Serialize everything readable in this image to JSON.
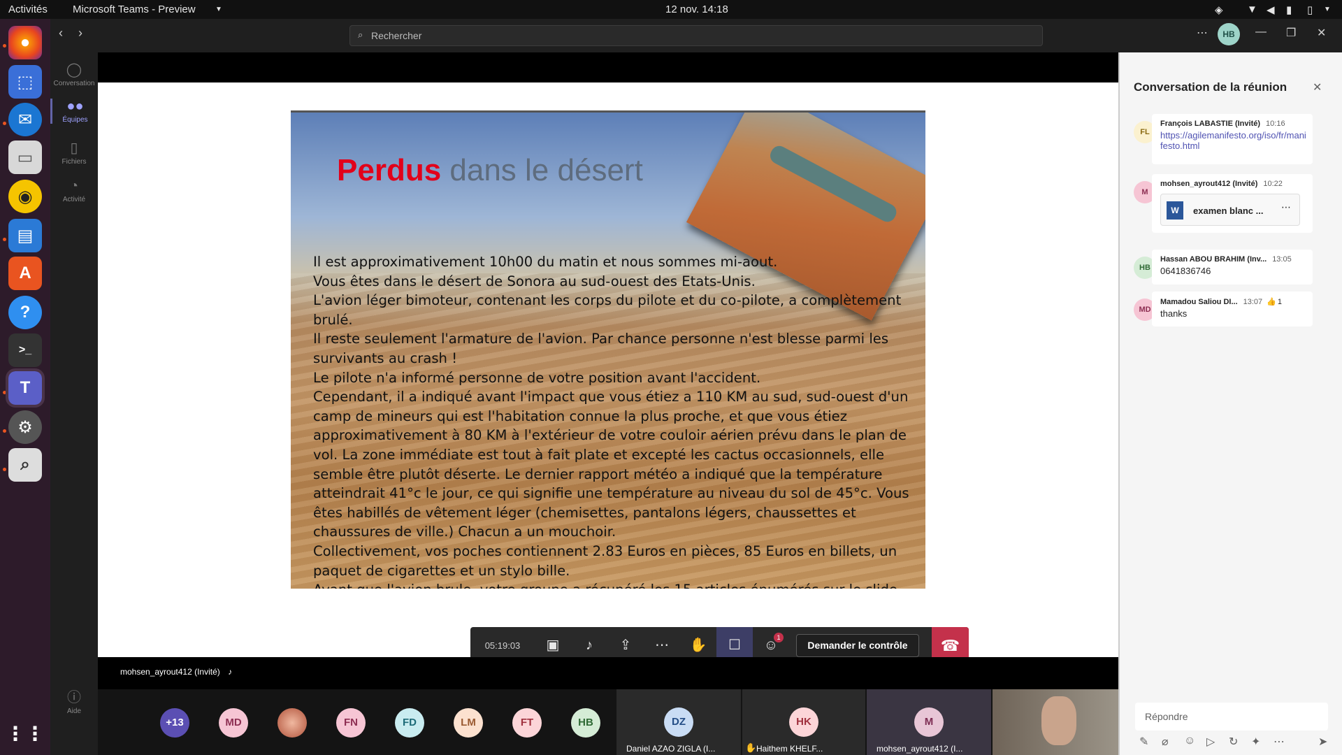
{
  "system": {
    "activities": "Activités",
    "app_name": "Microsoft Teams - Preview",
    "datetime": "12 nov.  14:18"
  },
  "dock": {
    "apps": [
      "Firefox",
      "Screenshot",
      "Thunderbird",
      "Files",
      "Rhythmbox",
      "LibreOffice Writer",
      "Ubuntu Software",
      "Help",
      "Terminal",
      "Microsoft Teams",
      "Settings",
      "Search"
    ]
  },
  "rail": {
    "items": [
      "Conversation",
      "Équipes",
      "Fichiers",
      "Activité"
    ],
    "help": "Aide"
  },
  "topbar": {
    "search_placeholder": "Rechercher",
    "user_initials": "HB"
  },
  "slide": {
    "title_red": "Perdus",
    "title_rest": " dans le désert",
    "lines": [
      "Il est approximativement 10h00 du matin et nous sommes mi-aout.",
      "Vous êtes dans le désert de Sonora au sud-ouest des Etats-Unis.",
      "L'avion léger bimoteur, contenant les corps du pilote et du co-pilote, a complètement brulé.",
      "Il reste seulement l'armature de l'avion. Par chance personne n'est blesse parmi les survivants au crash !",
      "Le pilote n'a informé personne de votre position avant l'accident.",
      "Cependant, il a indiqué avant l'impact que vous étiez a 110 KM au sud, sud-ouest d'un camp de mineurs qui est l'habitation connue la plus proche, et que vous étiez approximativement à 80 KM à l'extérieur de votre couloir aérien prévu dans le plan de vol. La zone immédiate est tout à fait plate et excepté les cactus occasionnels, elle semble être plutôt déserte. Le dernier rapport météo a indiqué que la température atteindrait 41°c le jour, ce qui signifie une température au niveau du sol de 45°c. Vous êtes habillés de vêtement léger (chemisettes, pantalons légers, chaussettes et chaussures de ville.) Chacun a un mouchoir.",
      "Collectivement, vos poches contiennent 2.83 Euros en pièces, 85 Euros en billets, un paquet de cigarettes et un stylo bille.",
      "Avant que l'avion brule, votre groupe a récupéré les 15 articles énumérés sur le slide suivant"
    ]
  },
  "controls": {
    "timer": "05:19:03",
    "participants_badge": "1",
    "request_control": "Demander le contrôle"
  },
  "presenter": {
    "name": "mohsen_ayrout412 (Invité)"
  },
  "participants": {
    "overflow": "+13",
    "avatars": [
      "MD",
      "",
      "FN",
      "FD",
      "LM",
      "FT",
      "HB"
    ],
    "tiles": [
      {
        "initials": "DZ",
        "name": "Daniel AZAO ZIGLA (I..."
      },
      {
        "initials": "HK",
        "name": "Haithem KHELF..."
      },
      {
        "initials": "M",
        "name": "mohsen_ayrout412 (I..."
      }
    ]
  },
  "chat": {
    "title": "Conversation de la réunion",
    "messages": [
      {
        "initials": "FL",
        "author": "François LABASTIE (Invité)",
        "time": "10:16",
        "text": "https://agilemanifesto.org/iso/fr/manifesto.html"
      },
      {
        "initials": "M",
        "author": "mohsen_ayrout412 (Invité)",
        "time": "10:22",
        "attachment": "examen blanc ..."
      },
      {
        "initials": "HB",
        "author": "Hassan ABOU BRAHIM (Inv...",
        "time": "13:05",
        "text": "0641836746"
      },
      {
        "initials": "MD",
        "author": "Mamadou Saliou DI...",
        "time": "13:07",
        "text": "thanks",
        "reaction": "1"
      }
    ],
    "reply_placeholder": "Répondre"
  },
  "colors": {
    "teams_purple": "#6264a7",
    "hangup": "#c4314b",
    "title_red": "#e2001a"
  }
}
